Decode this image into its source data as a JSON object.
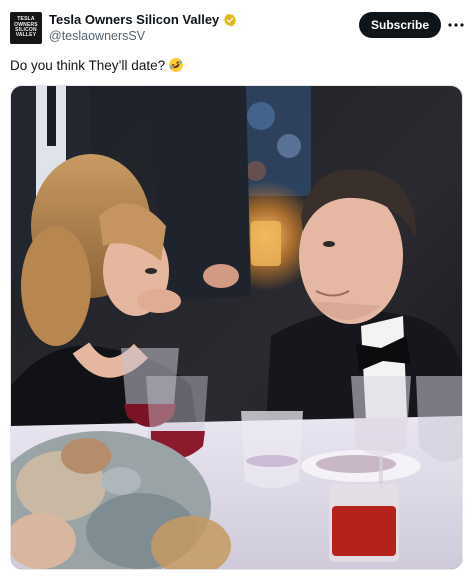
{
  "author": {
    "avatar_text": "TESLA\nOWNERS\nSILICON\nVALLEY",
    "display_name": "Tesla Owners Silicon Valley",
    "handle": "@teslaownersSV",
    "verified_icon": "verified-badge-icon",
    "verified_color": "#e2b719"
  },
  "actions": {
    "subscribe_label": "Subscribe",
    "more_icon": "more-options-icon"
  },
  "post": {
    "text": "Do you think They’ll date?",
    "emoji_icon": "rolling-on-floor-laughing-emoji"
  },
  "media": {
    "type": "photo",
    "icon": "photo-media"
  },
  "colors": {
    "accent": "#0f1419",
    "secondary_text": "#536471"
  }
}
